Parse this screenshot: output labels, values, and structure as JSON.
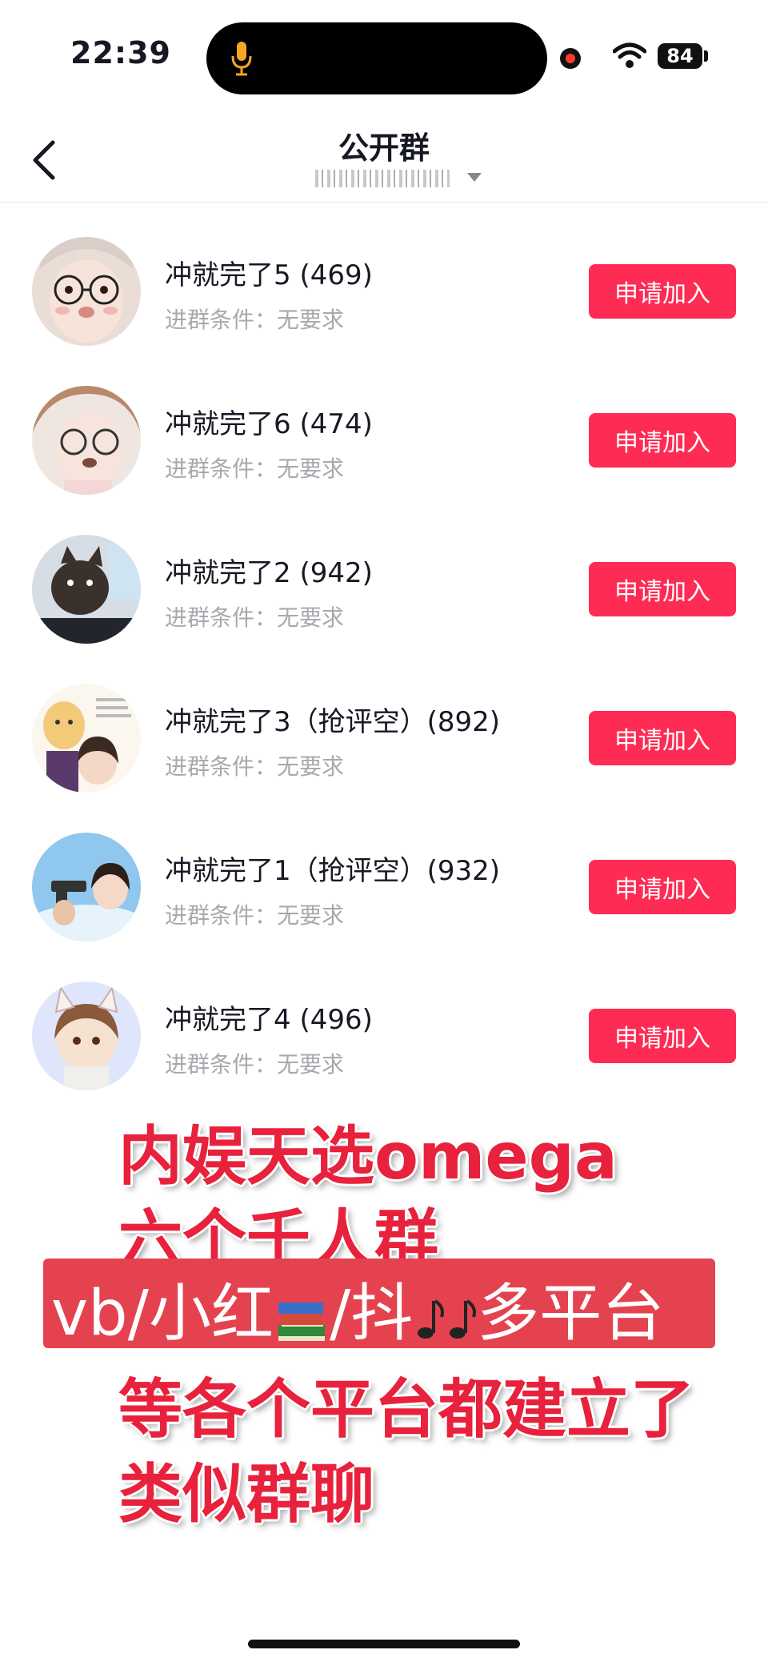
{
  "status_bar": {
    "time": "22:39",
    "battery": "84"
  },
  "nav": {
    "title": "公开群"
  },
  "groups": [
    {
      "name": "冲就完了5 (469)",
      "condition": "进群条件：无要求",
      "button": "申请加入"
    },
    {
      "name": "冲就完了6 (474)",
      "condition": "进群条件：无要求",
      "button": "申请加入"
    },
    {
      "name": "冲就完了2 (942)",
      "condition": "进群条件：无要求",
      "button": "申请加入"
    },
    {
      "name": "冲就完了3（抢评空）(892)",
      "condition": "进群条件：无要求",
      "button": "申请加入"
    },
    {
      "name": "冲就完了1（抢评空）(932)",
      "condition": "进群条件：无要求",
      "button": "申请加入"
    },
    {
      "name": "冲就完了4 (496)",
      "condition": "进群条件：无要求",
      "button": "申请加入"
    }
  ],
  "overlay": {
    "line1": "内娱天选omega",
    "line2": "六个千人群",
    "line3_a": "vb/小红",
    "line3_b": "/抖",
    "line3_c": "多平台",
    "line4": "等各个平台都建立了",
    "line5": "类似群聊"
  },
  "colors": {
    "accent": "#fe2c55",
    "overlay_red": "#e8213c"
  }
}
